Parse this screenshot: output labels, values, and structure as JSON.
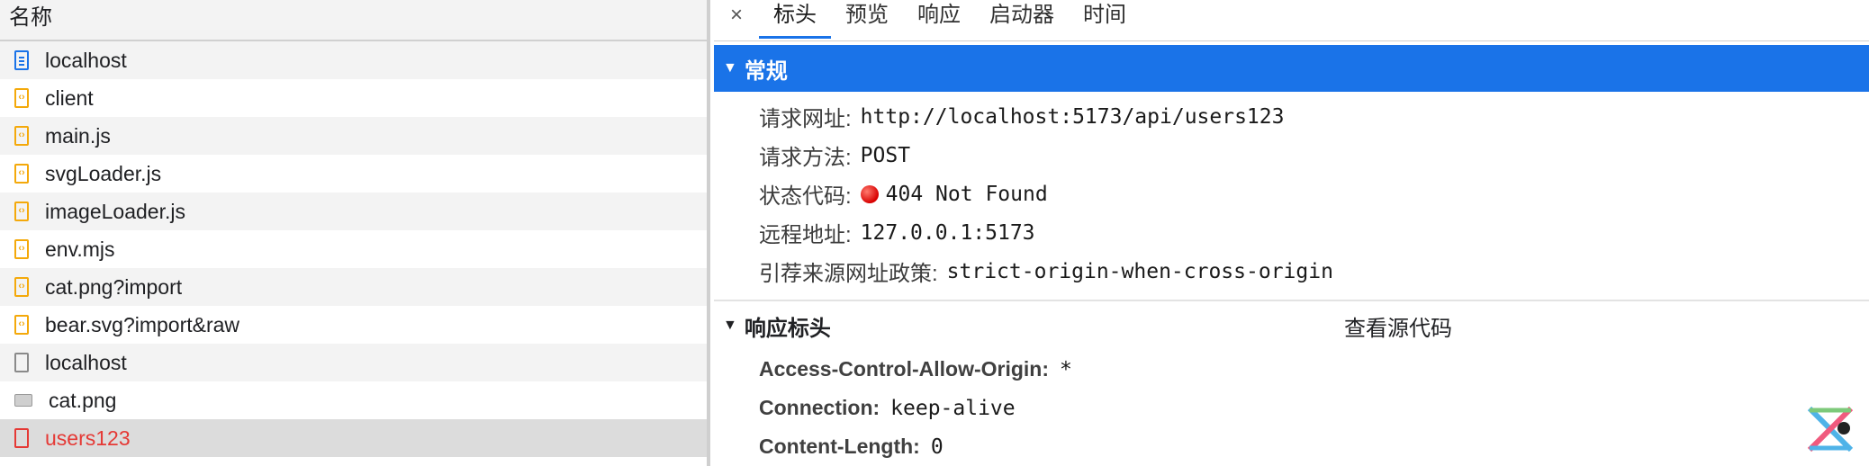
{
  "left": {
    "column_header": "名称",
    "files": [
      {
        "name": "localhost",
        "icon": "document-icon",
        "type": "doc",
        "selected": false
      },
      {
        "name": "client",
        "icon": "script-icon",
        "type": "script",
        "selected": false
      },
      {
        "name": "main.js",
        "icon": "script-icon",
        "type": "script",
        "selected": false
      },
      {
        "name": "svgLoader.js",
        "icon": "script-icon",
        "type": "script",
        "selected": false
      },
      {
        "name": "imageLoader.js",
        "icon": "script-icon",
        "type": "script",
        "selected": false
      },
      {
        "name": "env.mjs",
        "icon": "script-icon",
        "type": "script",
        "selected": false
      },
      {
        "name": "cat.png?import",
        "icon": "script-icon",
        "type": "script",
        "selected": false
      },
      {
        "name": "bear.svg?import&raw",
        "icon": "script-icon",
        "type": "script",
        "selected": false
      },
      {
        "name": "localhost",
        "icon": "blank-file-icon",
        "type": "blank",
        "selected": false
      },
      {
        "name": "cat.png",
        "icon": "image-icon",
        "type": "img",
        "selected": false
      },
      {
        "name": "users123",
        "icon": "error-file-icon",
        "type": "err",
        "selected": true
      }
    ]
  },
  "tabs": {
    "close_label": "×",
    "items": [
      "标头",
      "预览",
      "响应",
      "启动器",
      "时间"
    ],
    "active": "标头"
  },
  "general": {
    "title": "常规",
    "request_url_label": "请求网址:",
    "request_url": "http://localhost:5173/api/users123",
    "method_label": "请求方法:",
    "method": "POST",
    "status_label": "状态代码:",
    "status": "404 Not Found",
    "remote_label": "远程地址:",
    "remote": "127.0.0.1:5173",
    "referrer_label": "引荐来源网址政策:",
    "referrer": "strict-origin-when-cross-origin"
  },
  "response_headers": {
    "title": "响应标头",
    "view_source": "查看源代码",
    "items": [
      {
        "key": "Access-Control-Allow-Origin:",
        "value": "*"
      },
      {
        "key": "Connection:",
        "value": "keep-alive"
      },
      {
        "key": "Content-Length:",
        "value": "0"
      }
    ]
  },
  "colors": {
    "accent": "#1a73e8",
    "error": "#e53935",
    "script_icon": "#f4a90b"
  }
}
